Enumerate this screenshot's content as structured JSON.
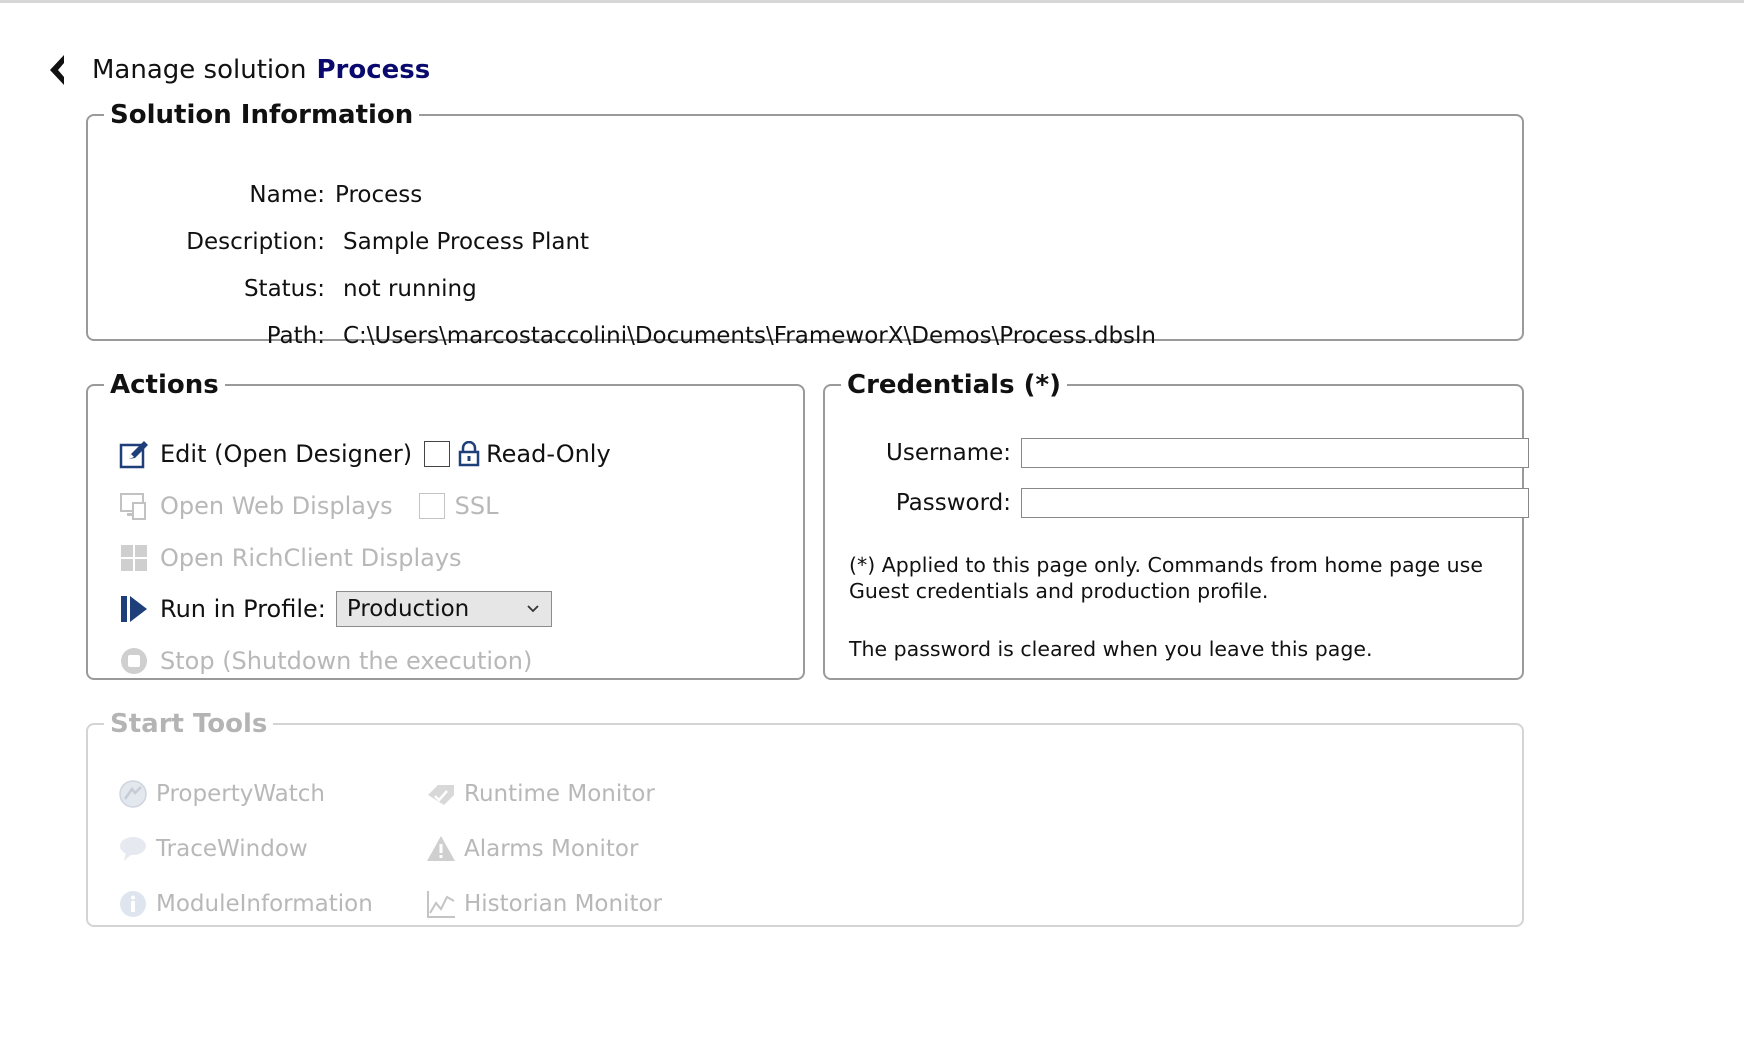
{
  "header": {
    "title": "Manage solution",
    "solution_name": "Process"
  },
  "solution_info": {
    "legend": "Solution Information",
    "rows": [
      {
        "label": "Name:",
        "value": "Process"
      },
      {
        "label": "Description:",
        "value": "Sample Process Plant"
      },
      {
        "label": "Status:",
        "value": "not running"
      },
      {
        "label": "Path:",
        "value": "C:\\Users\\marcostaccolini\\Documents\\FrameworX\\Demos\\Process.dbsln"
      }
    ]
  },
  "actions": {
    "legend": "Actions",
    "edit_label": "Edit (Open Designer)",
    "readonly_label": "Read-Only",
    "web_displays_label": "Open Web Displays",
    "ssl_label": "SSL",
    "richclient_label": "Open RichClient Displays",
    "run_label": "Run in Profile:",
    "profile_selected": "Production",
    "stop_label": "Stop (Shutdown the execution)"
  },
  "credentials": {
    "legend": "Credentials (*)",
    "username_label": "Username:",
    "password_label": "Password:",
    "username_value": "",
    "password_value": "",
    "note1": "(*) Applied to this page only. Commands from home page use Guest credentials and production profile.",
    "note2": "The password is cleared when you leave this page."
  },
  "start_tools": {
    "legend": "Start Tools",
    "property_watch": "PropertyWatch",
    "trace_window": "TraceWindow",
    "module_information": "ModuleInformation",
    "runtime_monitor": "Runtime Monitor",
    "alarms_monitor": "Alarms Monitor",
    "historian_monitor": "Historian Monitor"
  },
  "colors": {
    "accent": "#0a0a6e",
    "action_blue": "#1e3f7a",
    "disabled": "#b8b8b8"
  }
}
